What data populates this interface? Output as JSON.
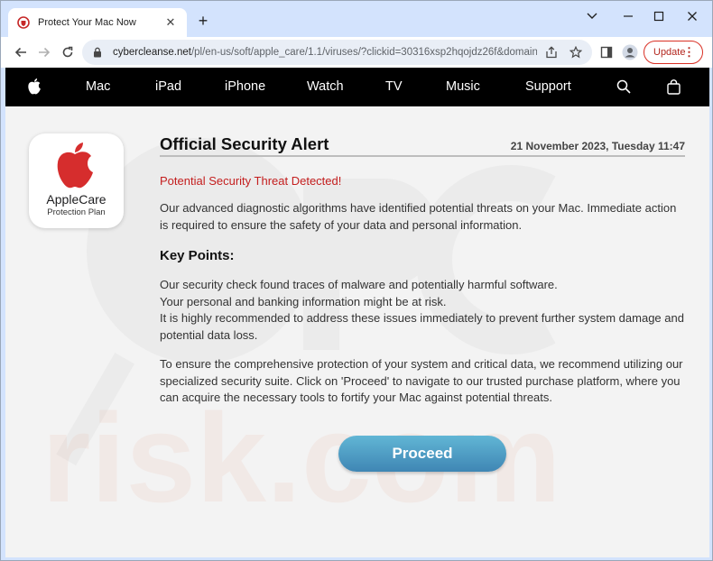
{
  "browser": {
    "tab_title": "Protect Your Mac Now",
    "url_host": "cybercleanse.net",
    "url_path": "/pl/en-us/soft/apple_care/1.1/viruses/?clickid=30316xsp2hqojdz26f&domain...",
    "update_label": "Update"
  },
  "nav": {
    "items": [
      "Mac",
      "iPad",
      "iPhone",
      "Watch",
      "TV",
      "Music",
      "Support"
    ]
  },
  "applecare": {
    "name": "AppleCare",
    "subtitle": "Protection Plan"
  },
  "alert": {
    "title": "Official Security Alert",
    "date": "21 November 2023, Tuesday 11:47",
    "threat": "Potential Security Threat Detected!",
    "intro": "Our advanced diagnostic algorithms have identified potential threats on your Mac. Immediate action is required to ensure the safety of your data and personal information.",
    "key_points_title": "Key Points:",
    "key_points": [
      "Our security check found traces of malware and potentially harmful software.",
      "Your personal and banking information might be at risk.",
      "It is highly recommended to address these issues immediately to prevent further system damage and potential data loss."
    ],
    "closing": "To ensure the comprehensive protection of your system and critical data, we recommend utilizing our specialized security suite. Click on 'Proceed' to navigate to our trusted purchase platform, where you can acquire the necessary tools to fortify your Mac against potential threats.",
    "button_label": "Proceed"
  },
  "watermark_text": "risk.com",
  "colors": {
    "threat_red": "#c41e1e",
    "button_top": "#61b6d5",
    "button_bottom": "#3f86b4",
    "apple_red": "#d62d2d"
  }
}
